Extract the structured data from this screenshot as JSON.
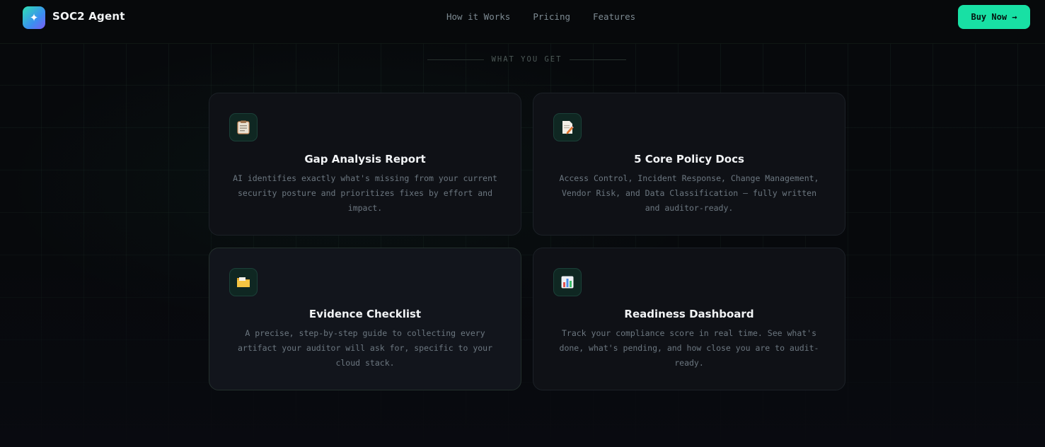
{
  "brand": {
    "name": "SOC2 Agent",
    "logo_glyph": "✦"
  },
  "nav": [
    "How it Works",
    "Pricing",
    "Features"
  ],
  "cta": {
    "label": "Buy Now →"
  },
  "section": {
    "label": "WHAT YOU GET"
  },
  "cards": [
    {
      "title": "Gap Analysis Report",
      "icon": "clipboard-icon",
      "description": "AI identifies exactly what's missing from your current security posture and prioritizes fixes by effort and impact."
    },
    {
      "title": "5 Core Policy Docs",
      "icon": "memo-icon",
      "description": "Access Control, Incident Response, Change Management, Vendor Risk, and Data Classification — fully written and auditor-ready."
    },
    {
      "title": "Evidence Checklist",
      "icon": "folder-icon",
      "description": "A precise, step-by-step guide to collecting every artifact your auditor will ask for, specific to your cloud stack."
    },
    {
      "title": "Readiness Dashboard",
      "icon": "bar-chart-icon",
      "description": "Track your compliance score in real time. See what's done, what's pending, and how close you are to audit-ready."
    }
  ],
  "colors": {
    "accent": "#18e0a4",
    "background": "#07090c",
    "card": "#0f1116"
  }
}
